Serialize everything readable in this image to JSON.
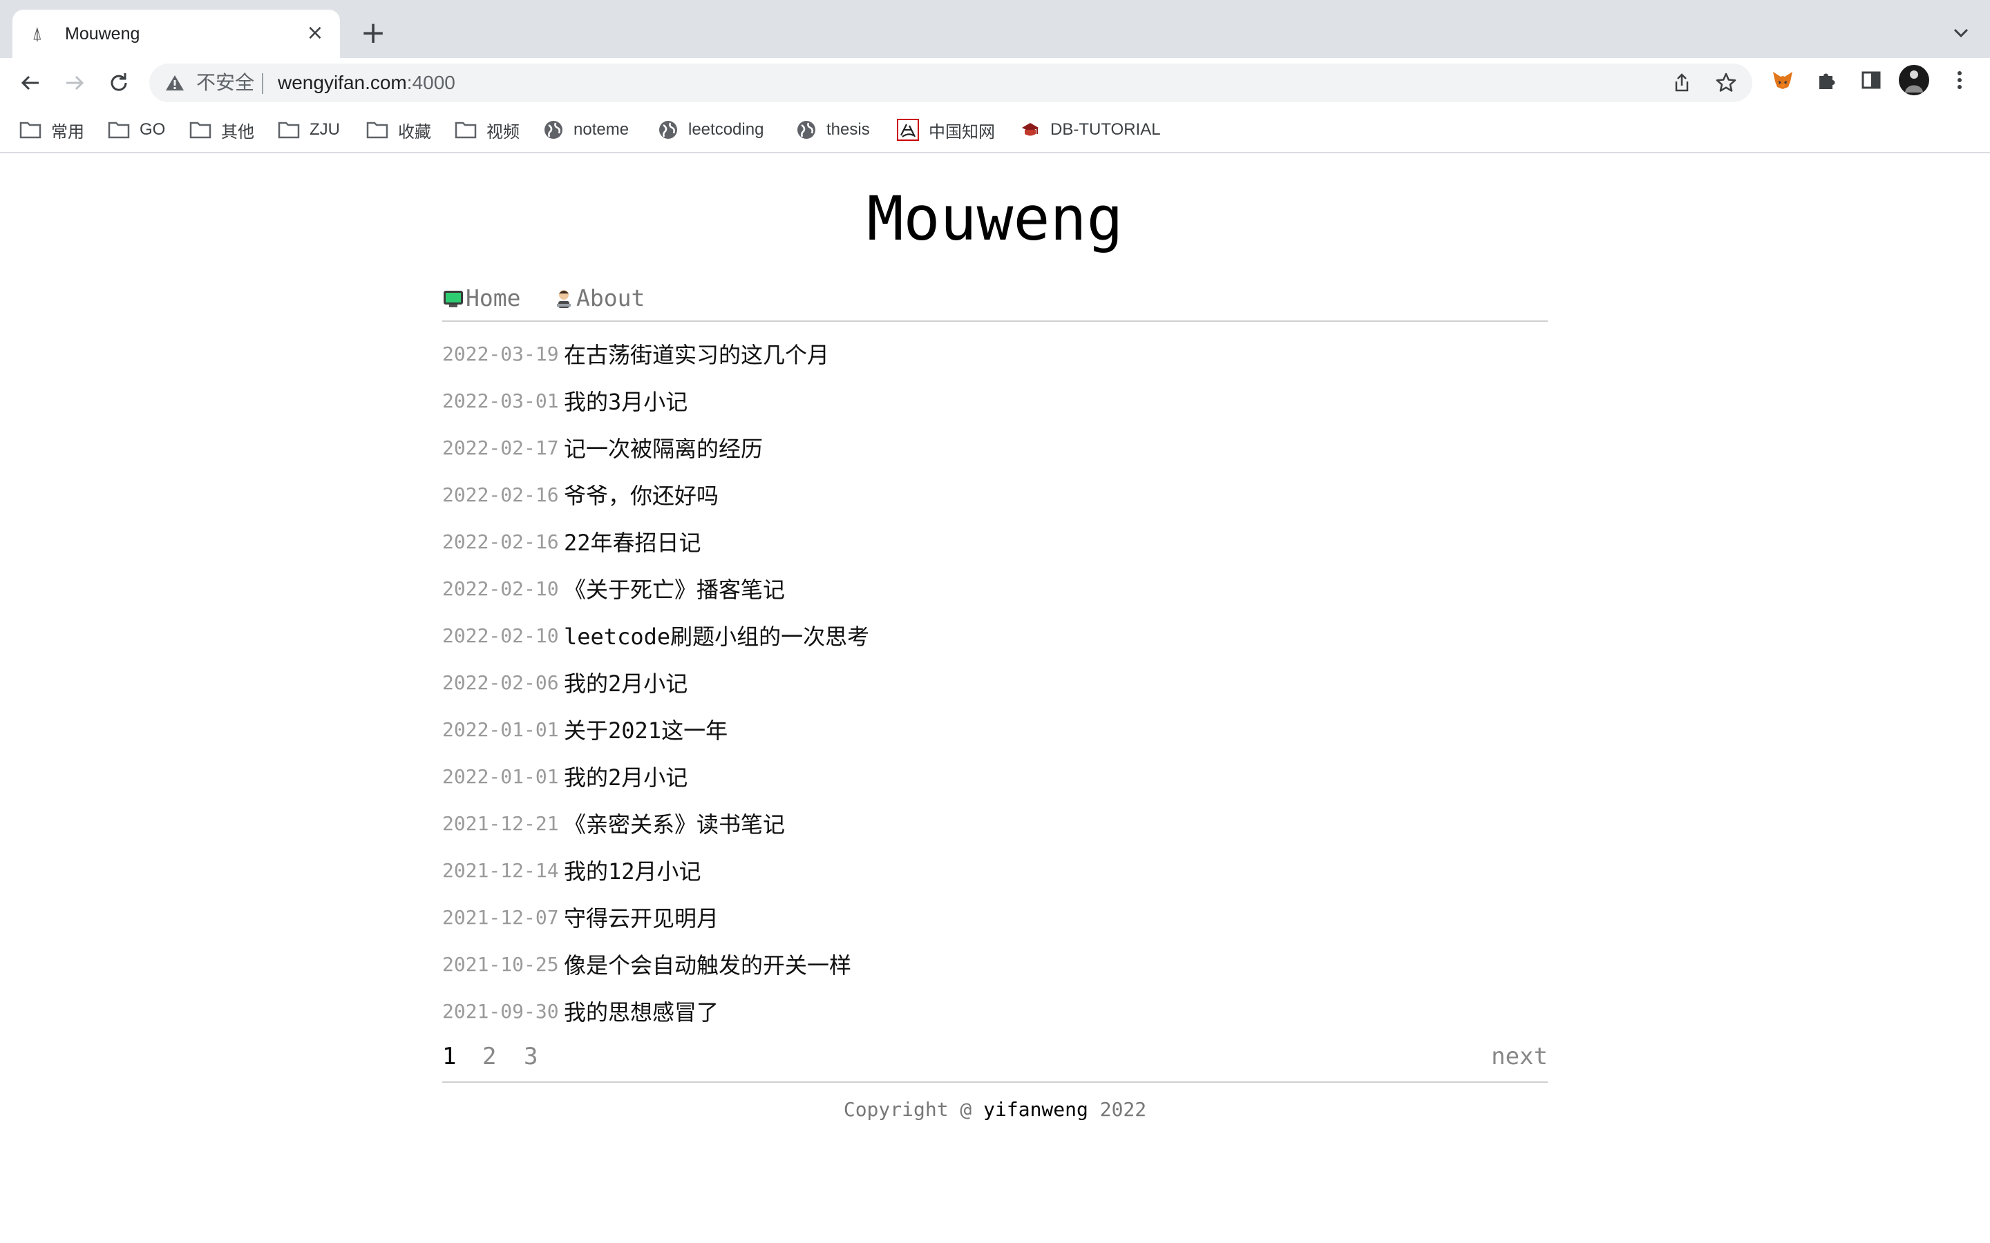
{
  "browser": {
    "tab_title": "Mouweng",
    "security_label": "不安全",
    "url_host": "wengyifan.com",
    "url_port": ":4000"
  },
  "bookmarks": [
    {
      "label": "常用",
      "icon": "folder-icon"
    },
    {
      "label": "GO",
      "icon": "folder-icon"
    },
    {
      "label": "其他",
      "icon": "folder-icon"
    },
    {
      "label": "ZJU",
      "icon": "folder-icon"
    },
    {
      "label": "收藏",
      "icon": "folder-icon"
    },
    {
      "label": "视频",
      "icon": "folder-icon"
    },
    {
      "label": "noteme",
      "icon": "globe-icon"
    },
    {
      "label": "leetcoding",
      "icon": "globe-icon"
    },
    {
      "label": "thesis",
      "icon": "globe-icon"
    },
    {
      "label": "中国知网",
      "icon": "cnki-icon"
    },
    {
      "label": "DB-TUTORIAL",
      "icon": "site-icon"
    }
  ],
  "site": {
    "title": "Mouweng",
    "nav": [
      {
        "label": "Home",
        "icon": "computer-emoji-icon"
      },
      {
        "label": "About",
        "icon": "person-emoji-icon"
      }
    ]
  },
  "posts": [
    {
      "date": "2022-03-19",
      "title": "在古荡街道实习的这几个月"
    },
    {
      "date": "2022-03-01",
      "title": "我的3月小记"
    },
    {
      "date": "2022-02-17",
      "title": "记一次被隔离的经历"
    },
    {
      "date": "2022-02-16",
      "title": "爷爷，你还好吗"
    },
    {
      "date": "2022-02-16",
      "title": "22年春招日记"
    },
    {
      "date": "2022-02-10",
      "title": "《关于死亡》播客笔记"
    },
    {
      "date": "2022-02-10",
      "title": "leetcode刷题小组的一次思考"
    },
    {
      "date": "2022-02-06",
      "title": "我的2月小记"
    },
    {
      "date": "2022-01-01",
      "title": "关于2021这一年"
    },
    {
      "date": "2022-01-01",
      "title": "我的2月小记"
    },
    {
      "date": "2021-12-21",
      "title": "《亲密关系》读书笔记"
    },
    {
      "date": "2021-12-14",
      "title": "我的12月小记"
    },
    {
      "date": "2021-12-07",
      "title": "守得云开见明月"
    },
    {
      "date": "2021-10-25",
      "title": "像是个会自动触发的开关一样"
    },
    {
      "date": "2021-09-30",
      "title": "我的思想感冒了"
    }
  ],
  "pagination": {
    "pages": [
      "1",
      "2",
      "3"
    ],
    "current": "1",
    "next_label": "next"
  },
  "footer": {
    "prefix": "Copyright @ ",
    "author": "yifanweng",
    "suffix": " 2022"
  }
}
